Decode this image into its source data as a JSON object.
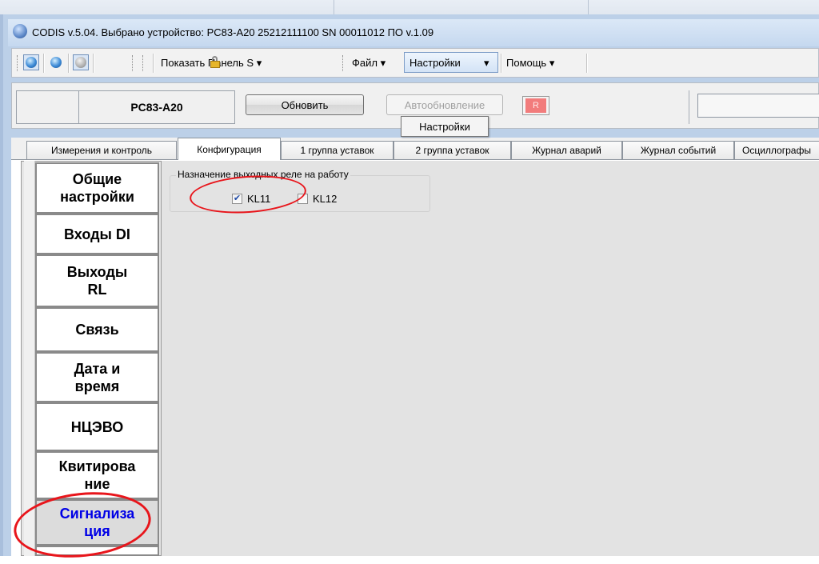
{
  "title_bar": {
    "text": "CODIS v.5.04.  Выбрано устройство:  PC83-A20  25212111100  SN 00011012  ПО v.1.09"
  },
  "toolbar": {
    "panel_label": "Показать Панель S",
    "menu": {
      "file": "Файл",
      "settings": "Настройки",
      "help": "Помощь"
    },
    "dropdown_arrow": "▾"
  },
  "device_bar": {
    "device_name": "PC83-A20",
    "refresh_label": "Обновить",
    "autorefresh_label": "Автообновление",
    "indicator_label": "R"
  },
  "tooltip": {
    "text": "Настройки"
  },
  "tabs": [
    {
      "label": "Измерения и контроль"
    },
    {
      "label": "Конфигурация"
    },
    {
      "label": "1 группа уставок"
    },
    {
      "label": "2 группа уставок"
    },
    {
      "label": "Журнал аварий"
    },
    {
      "label": "Журнал событий"
    },
    {
      "label": "Осциллографы"
    }
  ],
  "sidebar": {
    "items": [
      {
        "label": "Общие\nнастройки"
      },
      {
        "label": "Входы DI"
      },
      {
        "label": "Выходы\nRL"
      },
      {
        "label": "Связь"
      },
      {
        "label": "Дата и\nвремя"
      },
      {
        "label": "НЦЭВО"
      },
      {
        "label": "Квитирова\nние"
      },
      {
        "label": "Сигнализа\nция"
      }
    ]
  },
  "relay_group": {
    "title": "Назначение выходных реле на работу",
    "options": [
      {
        "label": "KL11",
        "checked": true
      },
      {
        "label": "KL12",
        "checked": false
      }
    ]
  },
  "colors": {
    "selected_text": "#0000e6",
    "annotation": "#e8151b"
  }
}
